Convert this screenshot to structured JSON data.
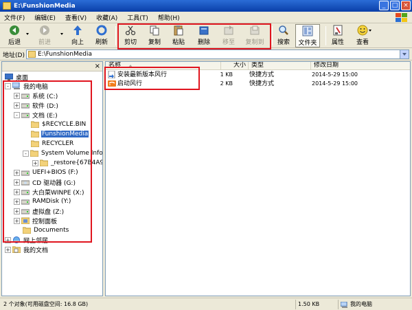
{
  "window": {
    "title": "E:\\FunshionMedia",
    "minimize_label": "_",
    "maximize_label": "□",
    "close_label": "×"
  },
  "menu": [
    "文件(F)",
    "编辑(E)",
    "查看(V)",
    "收藏(A)",
    "工具(T)",
    "帮助(H)"
  ],
  "toolbar": {
    "back": "后退",
    "forward": "前进",
    "up": "向上",
    "refresh": "刷新",
    "cut": "剪切",
    "copy": "复制",
    "paste": "粘贴",
    "delete": "删除",
    "move_to": "移至",
    "copy_to": "复制到",
    "search": "搜索",
    "folders": "文件夹",
    "properties": "属性",
    "views": "查看"
  },
  "address": {
    "label": "地址(D)",
    "path": "E:\\FunshionMedia"
  },
  "folder_pane": {
    "close_label": "×",
    "tree": {
      "desktop": "桌面",
      "my_computer": "我的电脑",
      "drive_c": "系统 (C:)",
      "drive_d": "软件 (D:)",
      "drive_e": "文档 (E:)",
      "recycle_bin": "$RECYCLE.BIN",
      "funshion_media": "FunshionMedia",
      "recycler": "RECYCLER",
      "system_volume": "System Volume Informat",
      "restore": "_restore{67B4A972",
      "drive_f": "UEFI+BIOS (F:)",
      "drive_g": "CD 驱动器 (G:)",
      "drive_x": "大白菜WINPE (X:)",
      "drive_y": "RAMDisk (Y:)",
      "drive_z": "虚拟盘 (Z:)",
      "control_panel": "控制面板",
      "documents": "Documents",
      "network": "网上邻居",
      "my_documents": "我的文档"
    },
    "expand_minus": "-",
    "expand_plus": "+"
  },
  "file_list": {
    "columns": {
      "name": "名称",
      "size": "大小",
      "type": "类型",
      "modified": "修改日期"
    },
    "rows": [
      {
        "name": "安装最新版本风行",
        "size": "1 KB",
        "type": "快捷方式",
        "modified": "2014-5-29 15:00"
      },
      {
        "name": "启动风行",
        "size": "2 KB",
        "type": "快捷方式",
        "modified": "2014-5-29 15:00"
      }
    ]
  },
  "status": {
    "objects": "2 个对象(可用磁盘空间: 16.8 GB)",
    "size": "1.50 KB",
    "location": "我的电脑"
  },
  "colors": {
    "titlebar": "#0a3fa8",
    "selection": "#316ac5",
    "annotation": "#e0141e"
  }
}
